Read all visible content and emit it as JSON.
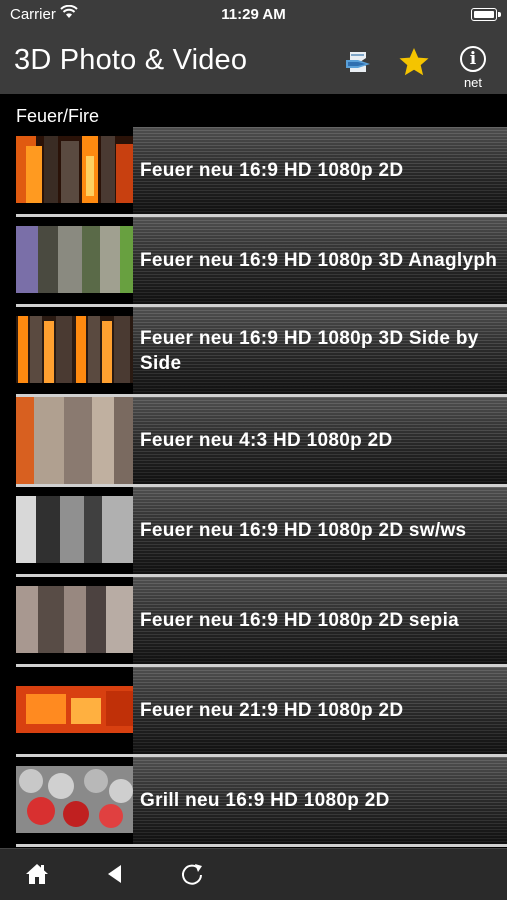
{
  "status": {
    "carrier": "Carrier",
    "time": "11:29 AM"
  },
  "header": {
    "title": "3D Photo & Video",
    "info_sub": "net",
    "info_glyph": "i",
    "icons": {
      "share": "share-icon",
      "favorite": "star-icon",
      "info": "info-icon"
    },
    "colors": {
      "star": "#f5c400",
      "bar": "#3c3c3c"
    }
  },
  "section": {
    "title": "Feuer/Fire"
  },
  "videos": [
    {
      "label": "Feuer neu 16:9 HD 1080p 2D"
    },
    {
      "label": "Feuer neu 16:9 HD 1080p 3D Anaglyph"
    },
    {
      "label": "Feuer neu 16:9 HD 1080p 3D Side by Side"
    },
    {
      "label": "Feuer neu 4:3 HD 1080p 2D"
    },
    {
      "label": "Feuer neu 16:9 HD 1080p 2D sw/ws"
    },
    {
      "label": "Feuer neu 16:9 HD 1080p 2D sepia"
    },
    {
      "label": "Feuer neu 21:9 HD 1080p 2D"
    },
    {
      "label": "Grill neu 16:9 HD 1080p 2D"
    }
  ],
  "toolbar": {
    "icons": [
      "home-icon",
      "back-icon",
      "reload-icon"
    ]
  }
}
